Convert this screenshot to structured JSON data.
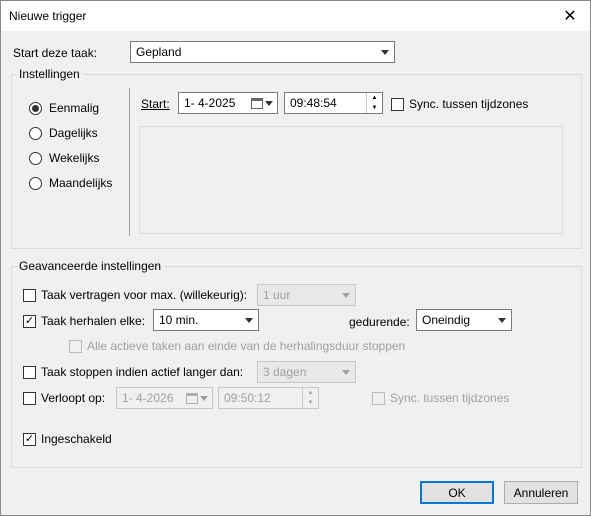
{
  "window": {
    "title": "Nieuwe trigger"
  },
  "start_task": {
    "label": "Start deze taak:",
    "value": "Gepland"
  },
  "settings": {
    "title": "Instellingen",
    "schedule_options": [
      "Eenmalig",
      "Dagelijks",
      "Wekelijks",
      "Maandelijks"
    ],
    "selected_option": "Eenmalig",
    "start_label": "Start:",
    "start_date": "1- 4-2025",
    "start_time": "09:48:54",
    "sync_label": "Sync. tussen tijdzones"
  },
  "advanced": {
    "title": "Geavanceerde instellingen",
    "delay_label": "Taak vertragen voor max. (willekeurig):",
    "delay_value": "1 uur",
    "repeat_label": "Taak herhalen elke:",
    "repeat_value": "10 min.",
    "duration_label": "gedurende:",
    "duration_value": "Oneindig",
    "stop_all_label": "Alle actieve taken aan einde van de herhalingsduur stoppen",
    "stop_if_label": "Taak stoppen indien actief langer dan:",
    "stop_if_value": "3 dagen",
    "expires_label": "Verloopt op:",
    "expires_date": "1- 4-2026",
    "expires_time": "09:50:12",
    "expires_sync_label": "Sync. tussen tijdzones",
    "enabled_label": "Ingeschakeld"
  },
  "buttons": {
    "ok": "OK",
    "cancel": "Annuleren"
  },
  "checkmark": "✓"
}
